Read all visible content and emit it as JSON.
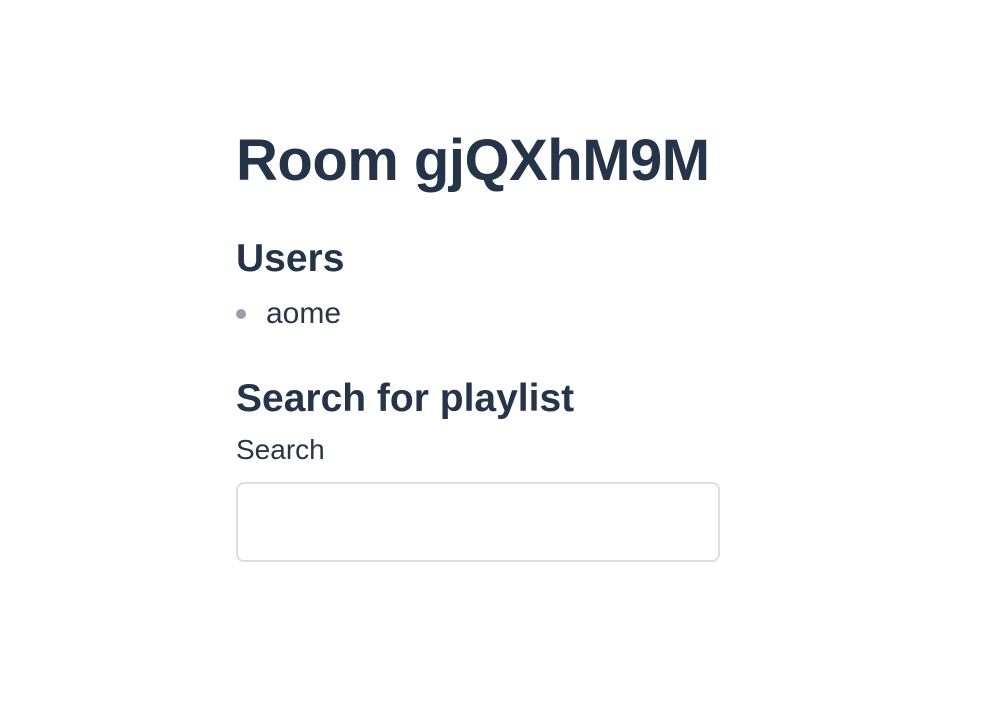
{
  "room": {
    "title": "Room gjQXhM9M"
  },
  "users": {
    "heading": "Users",
    "items": [
      {
        "name": "aome"
      }
    ]
  },
  "search": {
    "heading": "Search for playlist",
    "label": "Search",
    "value": "",
    "placeholder": ""
  }
}
